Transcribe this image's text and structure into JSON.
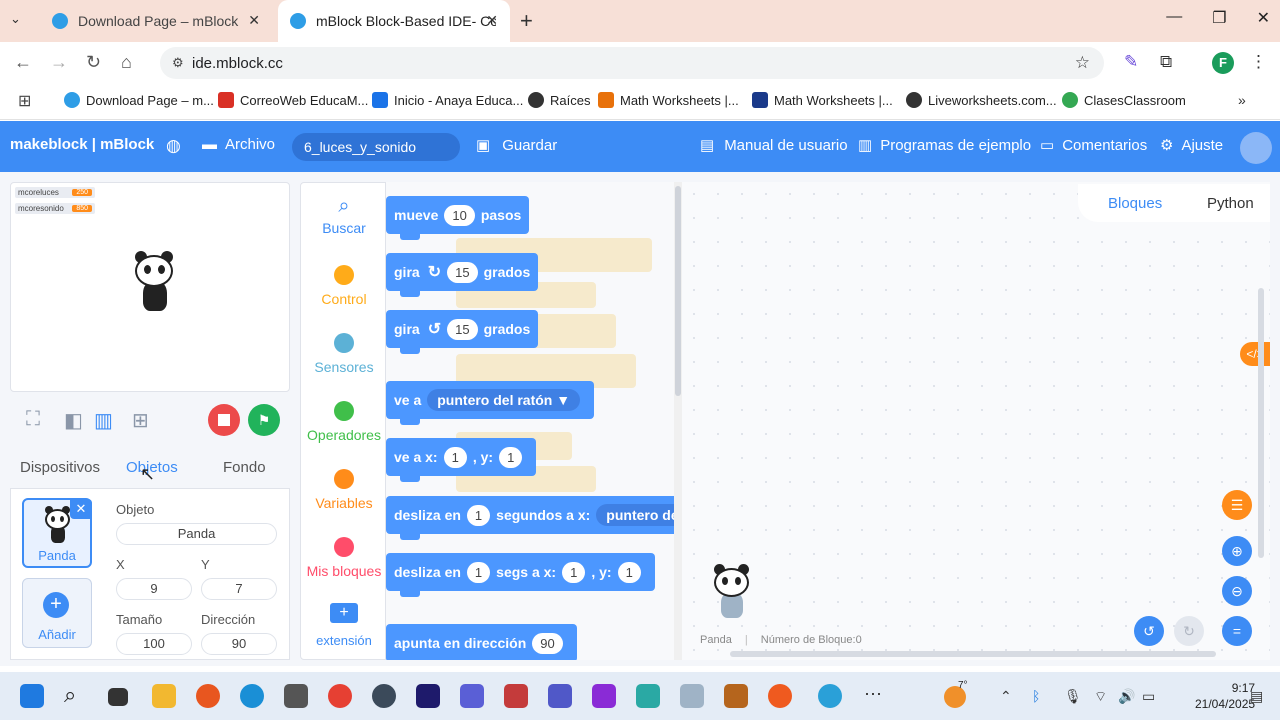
{
  "browser": {
    "tabs": [
      {
        "title": "Download Page – mBlock"
      },
      {
        "title": "mBlock Block-Based IDE- Codin"
      }
    ],
    "url": "ide.mblock.cc",
    "bookmarks": [
      {
        "label": "Download Page – m...",
        "color": "#2e9de6"
      },
      {
        "label": "CorreoWeb EducaM...",
        "color": "#d93025"
      },
      {
        "label": "Inicio - Anaya Educa...",
        "color": "#1a73e8"
      },
      {
        "label": "Raíces",
        "color": "#333333"
      },
      {
        "label": "Math Worksheets |...",
        "color": "#e8710a"
      },
      {
        "label": "Math Worksheets |...",
        "color": "#1a3a8a"
      },
      {
        "label": "Liveworksheets.com...",
        "color": "#333333"
      },
      {
        "label": "ClasesClassroom",
        "color": "#34a853"
      }
    ]
  },
  "header": {
    "brand": "makeblock | mBlock",
    "archivo": "Archivo",
    "project_name": "6_luces_y_sonido",
    "guardar": "Guardar",
    "manual": "Manual de usuario",
    "ejemplos": "Programas de ejemplo",
    "comentarios": "Comentarios",
    "ajuste": "Ajuste"
  },
  "stage": {
    "variables": [
      {
        "name": "mcoreluces",
        "value": "250"
      },
      {
        "name": "mcoresonido",
        "value": "850"
      }
    ]
  },
  "panel_tabs": {
    "dispositivos": "Dispositivos",
    "objetos": "Objetos",
    "fondo": "Fondo"
  },
  "object": {
    "sprite_name": "Panda",
    "add_label": "Añadir",
    "objeto_label": "Objeto",
    "objeto_value": "Panda",
    "x_label": "X",
    "x_value": "9",
    "y_label": "Y",
    "y_value": "7",
    "size_label": "Tamaño",
    "size_value": "100",
    "dir_label": "Dirección",
    "dir_value": "90"
  },
  "categories": [
    {
      "label": "Buscar",
      "color": "#3d8cf5"
    },
    {
      "label": "Control",
      "color": "#ffab19"
    },
    {
      "label": "Sensores",
      "color": "#5cb1d6"
    },
    {
      "label": "Operadores",
      "color": "#40bf4a"
    },
    {
      "label": "Variables",
      "color": "#ff8c1a"
    },
    {
      "label": "Mis bloques",
      "color": "#ff4d6a"
    },
    {
      "label": "extensión",
      "color": "#3d8cf5"
    }
  ],
  "blocks": {
    "mueve": {
      "a": "mueve",
      "v": "10",
      "b": "pasos"
    },
    "gira_r": {
      "a": "gira",
      "icon": "↻",
      "v": "15",
      "b": "grados"
    },
    "gira_l": {
      "a": "gira",
      "icon": "↺",
      "v": "15",
      "b": "grados"
    },
    "ve_a": {
      "a": "ve a",
      "dd": "puntero del ratón ▼"
    },
    "ve_a_xy": {
      "a": "ve a x:",
      "x": "1",
      "b": ", y:",
      "y": "1"
    },
    "desliza1": {
      "a": "desliza en",
      "v": "1",
      "b": "segundos a x:",
      "dd": "puntero del"
    },
    "desliza2": {
      "a": "desliza en",
      "v": "1",
      "b": "segs a x:",
      "x": "1",
      "c": ", y:",
      "y": "1"
    },
    "apunta": {
      "a": "apunta en dirección",
      "v": "90"
    }
  },
  "script_area": {
    "mode_blocks": "Bloques",
    "mode_python": "Python",
    "code_icon": "</>",
    "footer_sprite": "Panda",
    "footer_block_count": "Número de Bloque:0"
  },
  "taskbar": {
    "weather": "7°",
    "time": "9:17",
    "date": "21/04/2025"
  }
}
